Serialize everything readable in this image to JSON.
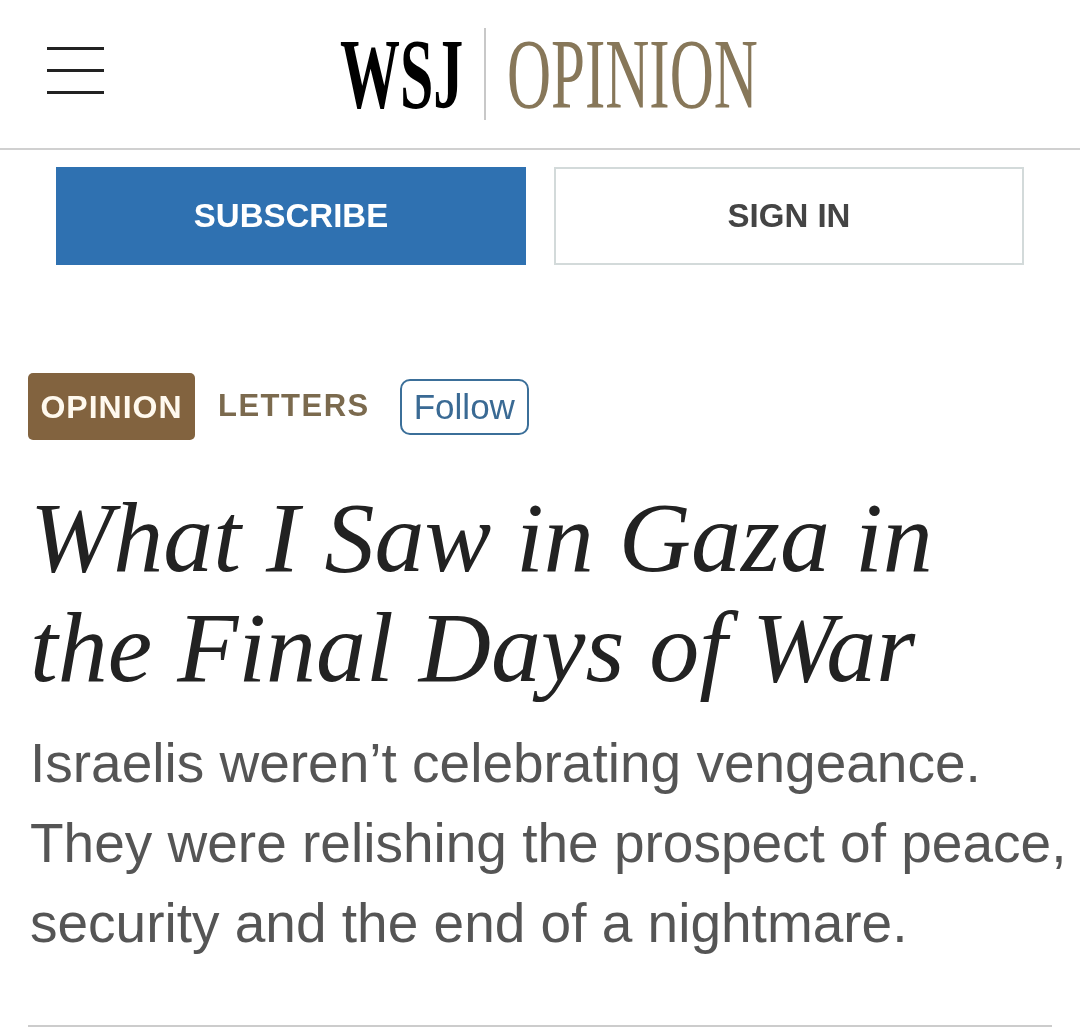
{
  "header": {
    "logo": {
      "brand": "WSJ",
      "section": "OPINION"
    }
  },
  "account_buttons": [
    {
      "label": "SUBSCRIBE",
      "kind": "primary"
    },
    {
      "label": "SIGN IN",
      "kind": "secondary"
    }
  ],
  "article": {
    "section_badge": "OPINION",
    "category": "LETTERS",
    "follow_button": "Follow",
    "headline": "What I Saw in Gaza in the Final Days of War",
    "dek": "Israelis weren’t celebrating vengeance. They were relishing the prospect of peace, security and the end of a nightmare."
  }
}
